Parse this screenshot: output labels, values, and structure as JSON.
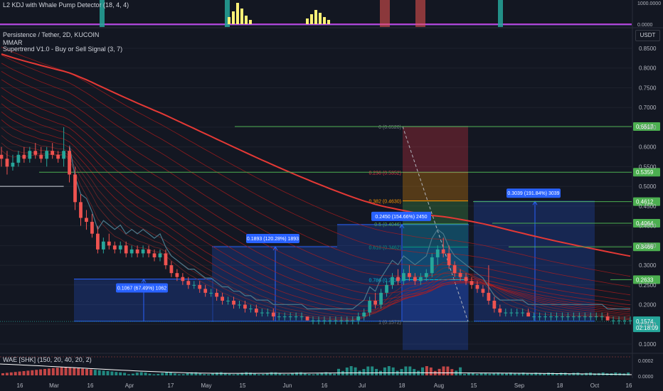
{
  "kdj_panel": {
    "legend": "L2 KDJ with Whale Pump Detector (18, 4, 4)",
    "axis_labels": [
      "1000.0000",
      "0.0000"
    ]
  },
  "main_panel": {
    "title": "Persistence / Tether, 2D, KUCOIN",
    "indicator_1": "MMAR",
    "indicator_2": "Supertrend V1.0 - Buy or Sell Signal (3, 7)",
    "currency": "USDT"
  },
  "wae_panel": {
    "legend": "WAE [SHK] (150, 20, 40, 20, 2)",
    "axis_labels": [
      "0.0002",
      "0.0000"
    ]
  },
  "colors": {
    "bg": "#131722",
    "up": "#26a69a",
    "down": "#ef5350",
    "green_line": "#4caf50",
    "red_ema": "#e53935",
    "supertrend": "#4a7a8c",
    "accent_blue": "#2962ff",
    "kdj_pink": "#e040fb",
    "kdj_yellow": "#fff176"
  },
  "chart_data": {
    "type": "candlestick",
    "title": "Persistence / Tether, 2D, KUCOIN",
    "ylim": [
      0.08,
      0.87
    ],
    "y_ticks": [
      "0.8500",
      "0.8000",
      "0.7500",
      "0.7000",
      "0.6500",
      "0.6000",
      "0.5500",
      "0.5000",
      "0.4500",
      "0.4000",
      "0.3500",
      "0.3000",
      "0.2500",
      "0.2000",
      "0.1500",
      "0.1000"
    ],
    "x_ticks": [
      "16",
      "Mar",
      "16",
      "Apr",
      "17",
      "May",
      "15",
      "Jun",
      "16",
      "Jul",
      "18",
      "Aug",
      "15",
      "Sep",
      "18",
      "Oct",
      "16"
    ],
    "horizontal_levels": [
      {
        "label": "0.6517",
        "value": 0.6517
      },
      {
        "label": "0.5359",
        "value": 0.5359
      },
      {
        "label": "0.4612",
        "value": 0.4612
      },
      {
        "label": "0.4064",
        "value": 0.4064
      },
      {
        "label": "0.3466",
        "value": 0.3466
      },
      {
        "label": "0.2633",
        "value": 0.2633
      }
    ],
    "current_price": {
      "label": "0.1574",
      "value": 0.1574,
      "countdown": "02:18:09"
    },
    "fibonacci": [
      {
        "label": "0 (0.6520)",
        "value": 0.652
      },
      {
        "label": "0.236 (0.5352)",
        "value": 0.5352
      },
      {
        "label": "0.382 (0.4630)",
        "value": 0.463
      },
      {
        "label": "0.5 (0.4046)",
        "value": 0.4046
      },
      {
        "label": "0.618 (0.3462)",
        "value": 0.3462
      },
      {
        "label": "0.786 (0.2631)",
        "value": 0.2631
      },
      {
        "label": "1 (0.1572)",
        "value": 0.1572
      }
    ],
    "range_measures": [
      {
        "label": "0.1067 (67.49%) 1062",
        "from": 0.158,
        "to": 0.265
      },
      {
        "label": "0.1893 (120.28%) 1893",
        "from": 0.158,
        "to": 0.347
      },
      {
        "label": "0.2450 (154.66%) 2450",
        "from": 0.158,
        "to": 0.403
      },
      {
        "label": "0.3039 (191.84%) 3039",
        "from": 0.158,
        "to": 0.462
      }
    ],
    "candles": [
      [
        0.58,
        0.6,
        0.55,
        0.57
      ],
      [
        0.57,
        0.59,
        0.53,
        0.55
      ],
      [
        0.55,
        0.58,
        0.54,
        0.56
      ],
      [
        0.56,
        0.59,
        0.55,
        0.58
      ],
      [
        0.58,
        0.6,
        0.56,
        0.57
      ],
      [
        0.57,
        0.6,
        0.56,
        0.59
      ],
      [
        0.59,
        0.61,
        0.57,
        0.58
      ],
      [
        0.58,
        0.6,
        0.56,
        0.57
      ],
      [
        0.57,
        0.6,
        0.55,
        0.59
      ],
      [
        0.59,
        0.61,
        0.57,
        0.58
      ],
      [
        0.58,
        0.59,
        0.56,
        0.57
      ],
      [
        0.57,
        0.65,
        0.55,
        0.59
      ],
      [
        0.59,
        0.6,
        0.51,
        0.53
      ],
      [
        0.53,
        0.55,
        0.44,
        0.46
      ],
      [
        0.46,
        0.48,
        0.4,
        0.42
      ],
      [
        0.42,
        0.44,
        0.39,
        0.41
      ],
      [
        0.41,
        0.43,
        0.37,
        0.38
      ],
      [
        0.38,
        0.4,
        0.33,
        0.34
      ],
      [
        0.34,
        0.37,
        0.33,
        0.36
      ],
      [
        0.36,
        0.38,
        0.34,
        0.35
      ],
      [
        0.35,
        0.36,
        0.33,
        0.34
      ],
      [
        0.34,
        0.36,
        0.33,
        0.35
      ],
      [
        0.35,
        0.36,
        0.32,
        0.33
      ],
      [
        0.33,
        0.35,
        0.32,
        0.34
      ],
      [
        0.34,
        0.35,
        0.32,
        0.33
      ],
      [
        0.33,
        0.35,
        0.32,
        0.34
      ],
      [
        0.34,
        0.35,
        0.32,
        0.33
      ],
      [
        0.33,
        0.34,
        0.31,
        0.32
      ],
      [
        0.32,
        0.34,
        0.31,
        0.33
      ],
      [
        0.33,
        0.34,
        0.29,
        0.3
      ],
      [
        0.3,
        0.31,
        0.27,
        0.28
      ],
      [
        0.28,
        0.29,
        0.26,
        0.27
      ],
      [
        0.27,
        0.28,
        0.25,
        0.26
      ],
      [
        0.26,
        0.27,
        0.24,
        0.25
      ],
      [
        0.25,
        0.26,
        0.24,
        0.25
      ],
      [
        0.25,
        0.26,
        0.23,
        0.24
      ],
      [
        0.24,
        0.25,
        0.22,
        0.23
      ],
      [
        0.23,
        0.24,
        0.22,
        0.23
      ],
      [
        0.23,
        0.24,
        0.21,
        0.22
      ],
      [
        0.22,
        0.23,
        0.2,
        0.21
      ],
      [
        0.21,
        0.22,
        0.2,
        0.21
      ],
      [
        0.21,
        0.22,
        0.19,
        0.2
      ],
      [
        0.2,
        0.21,
        0.19,
        0.2
      ],
      [
        0.2,
        0.21,
        0.18,
        0.19
      ],
      [
        0.19,
        0.2,
        0.18,
        0.19
      ],
      [
        0.19,
        0.2,
        0.17,
        0.18
      ],
      [
        0.18,
        0.19,
        0.17,
        0.18
      ],
      [
        0.18,
        0.19,
        0.17,
        0.18
      ],
      [
        0.18,
        0.19,
        0.16,
        0.17
      ],
      [
        0.17,
        0.18,
        0.16,
        0.17
      ],
      [
        0.17,
        0.18,
        0.16,
        0.17
      ],
      [
        0.17,
        0.18,
        0.16,
        0.17
      ],
      [
        0.17,
        0.18,
        0.16,
        0.17
      ],
      [
        0.17,
        0.18,
        0.16,
        0.17
      ],
      [
        0.17,
        0.17,
        0.16,
        0.16
      ],
      [
        0.16,
        0.17,
        0.15,
        0.16
      ],
      [
        0.16,
        0.17,
        0.15,
        0.16
      ],
      [
        0.16,
        0.17,
        0.15,
        0.16
      ],
      [
        0.16,
        0.17,
        0.15,
        0.16
      ],
      [
        0.16,
        0.17,
        0.15,
        0.16
      ],
      [
        0.16,
        0.17,
        0.15,
        0.16
      ],
      [
        0.16,
        0.17,
        0.15,
        0.16
      ],
      [
        0.16,
        0.17,
        0.15,
        0.16
      ],
      [
        0.16,
        0.18,
        0.15,
        0.17
      ],
      [
        0.17,
        0.19,
        0.16,
        0.18
      ],
      [
        0.18,
        0.22,
        0.17,
        0.21
      ],
      [
        0.21,
        0.23,
        0.19,
        0.2
      ],
      [
        0.2,
        0.24,
        0.19,
        0.23
      ],
      [
        0.23,
        0.26,
        0.22,
        0.25
      ],
      [
        0.25,
        0.28,
        0.24,
        0.27
      ],
      [
        0.27,
        0.29,
        0.25,
        0.26
      ],
      [
        0.26,
        0.29,
        0.25,
        0.28
      ],
      [
        0.28,
        0.3,
        0.26,
        0.27
      ],
      [
        0.27,
        0.28,
        0.25,
        0.26
      ],
      [
        0.26,
        0.28,
        0.25,
        0.27
      ],
      [
        0.27,
        0.29,
        0.26,
        0.28
      ],
      [
        0.28,
        0.33,
        0.27,
        0.32
      ],
      [
        0.32,
        0.35,
        0.3,
        0.34
      ],
      [
        0.34,
        0.37,
        0.32,
        0.33
      ],
      [
        0.33,
        0.35,
        0.29,
        0.3
      ],
      [
        0.3,
        0.31,
        0.27,
        0.28
      ],
      [
        0.28,
        0.29,
        0.26,
        0.27
      ],
      [
        0.27,
        0.28,
        0.25,
        0.26
      ],
      [
        0.26,
        0.27,
        0.24,
        0.25
      ],
      [
        0.25,
        0.26,
        0.23,
        0.24
      ],
      [
        0.24,
        0.25,
        0.22,
        0.23
      ],
      [
        0.23,
        0.3,
        0.2,
        0.21
      ],
      [
        0.21,
        0.22,
        0.18,
        0.19
      ],
      [
        0.19,
        0.2,
        0.17,
        0.18
      ],
      [
        0.18,
        0.19,
        0.17,
        0.18
      ],
      [
        0.18,
        0.19,
        0.17,
        0.18
      ],
      [
        0.18,
        0.19,
        0.17,
        0.18
      ],
      [
        0.18,
        0.19,
        0.17,
        0.18
      ],
      [
        0.18,
        0.19,
        0.17,
        0.17
      ],
      [
        0.17,
        0.18,
        0.16,
        0.17
      ],
      [
        0.17,
        0.18,
        0.16,
        0.17
      ],
      [
        0.17,
        0.18,
        0.16,
        0.17
      ],
      [
        0.17,
        0.18,
        0.16,
        0.17
      ],
      [
        0.17,
        0.18,
        0.16,
        0.17
      ],
      [
        0.17,
        0.18,
        0.16,
        0.17
      ],
      [
        0.17,
        0.18,
        0.16,
        0.17
      ],
      [
        0.17,
        0.18,
        0.16,
        0.17
      ],
      [
        0.17,
        0.18,
        0.16,
        0.17
      ],
      [
        0.17,
        0.18,
        0.16,
        0.17
      ],
      [
        0.17,
        0.18,
        0.16,
        0.17
      ],
      [
        0.17,
        0.18,
        0.16,
        0.17
      ],
      [
        0.17,
        0.18,
        0.16,
        0.17
      ],
      [
        0.17,
        0.18,
        0.16,
        0.16
      ],
      [
        0.16,
        0.17,
        0.15,
        0.16
      ],
      [
        0.16,
        0.17,
        0.15,
        0.16
      ],
      [
        0.16,
        0.17,
        0.15,
        0.16
      ],
      [
        0.16,
        0.17,
        0.15,
        0.16
      ]
    ]
  }
}
